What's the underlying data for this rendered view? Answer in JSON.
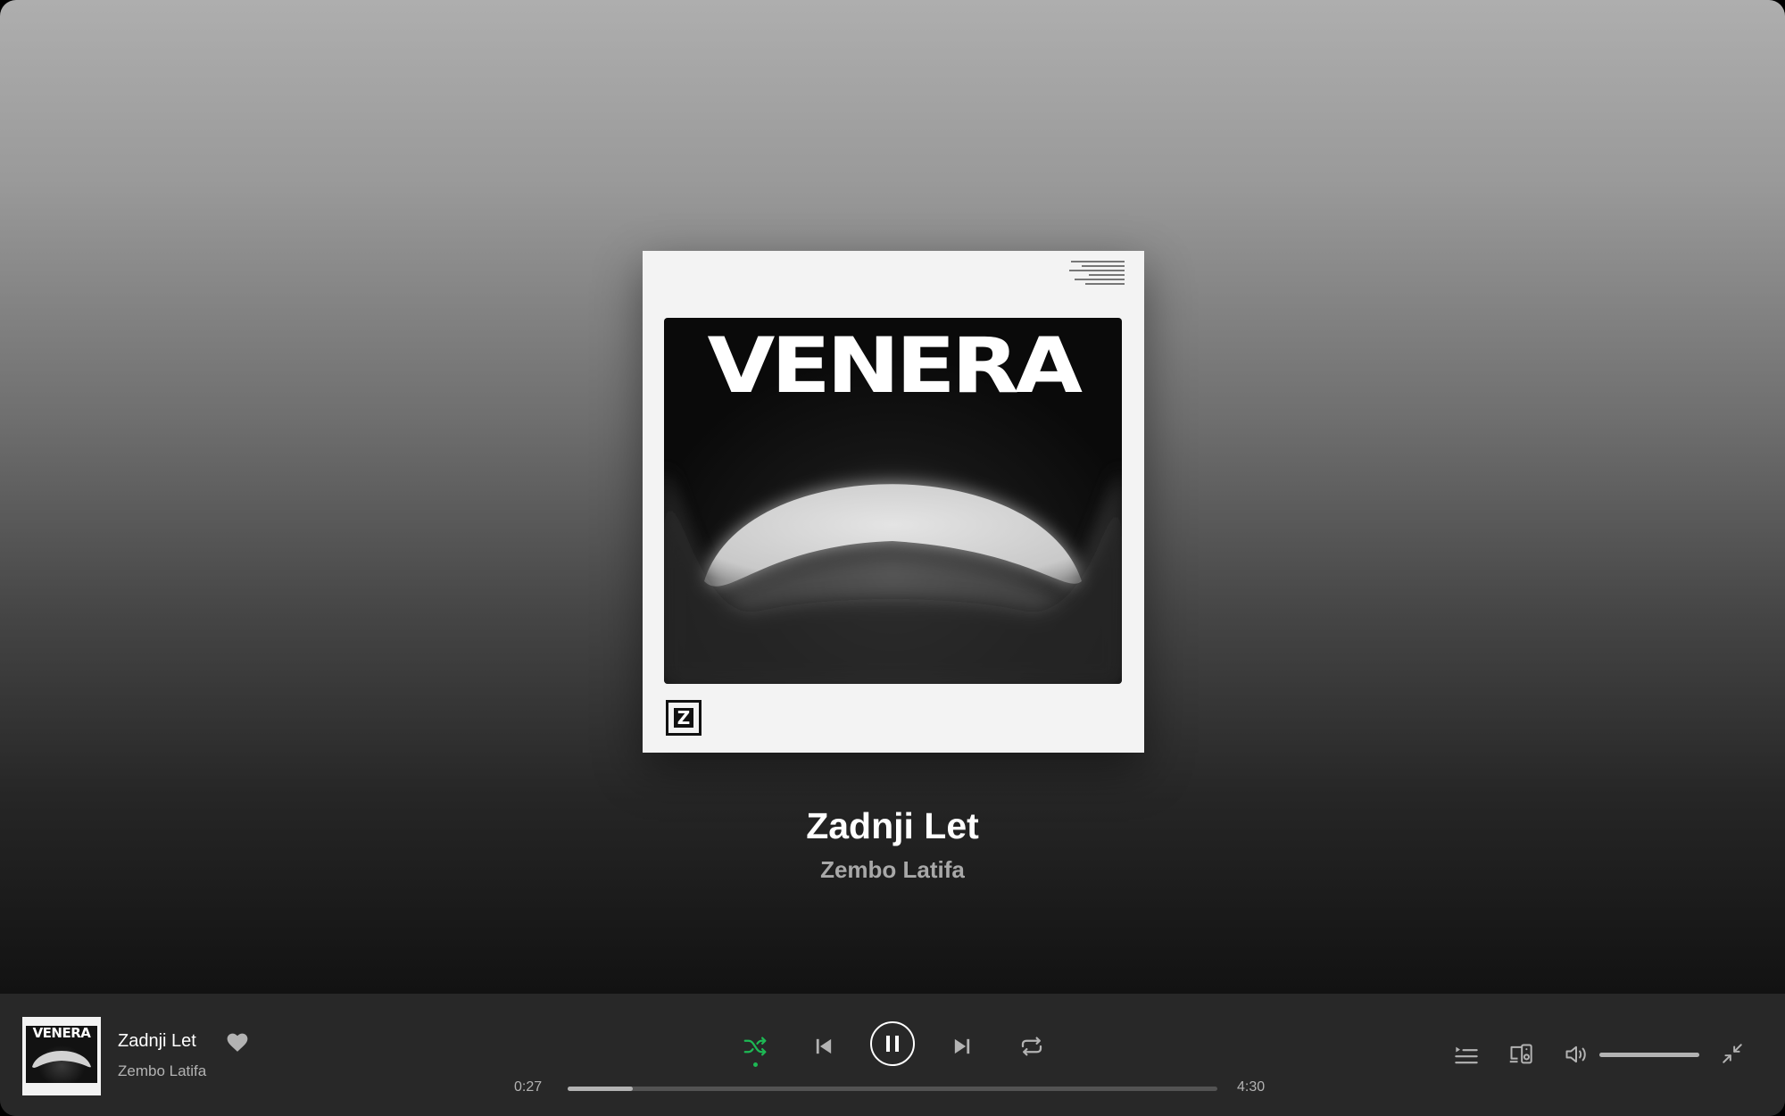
{
  "cover": {
    "title_text": "VENERA",
    "logo_letter": "Z"
  },
  "now_playing": {
    "title": "Zadnji Let",
    "artist": "Zembo Latifa"
  },
  "player": {
    "thumb_title": "VENERA",
    "track_title": "Zadnji Let",
    "track_artist": "Zembo Latifa",
    "elapsed": "0:27",
    "total": "4:30",
    "progress_fraction": 0.1,
    "volume_fraction": 1.0,
    "shuffle_active": true,
    "accent_color": "#1db954",
    "icons": [
      "heart-icon",
      "shuffle-icon",
      "previous-icon",
      "pause-icon",
      "next-icon",
      "repeat-icon",
      "queue-icon",
      "connect-device-icon",
      "volume-icon",
      "minimize-icon"
    ]
  }
}
